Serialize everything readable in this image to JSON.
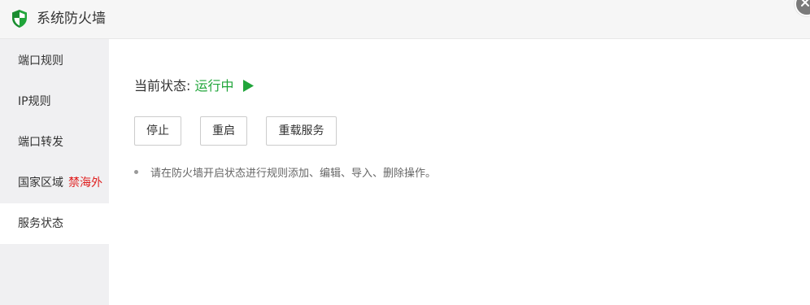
{
  "window": {
    "title": "系统防火墙"
  },
  "sidebar": {
    "items": [
      {
        "label": "端口规则"
      },
      {
        "label": "IP规则"
      },
      {
        "label": "端口转发"
      },
      {
        "label": "国家区域",
        "badge": "禁海外"
      },
      {
        "label": "服务状态",
        "active": true
      }
    ]
  },
  "main": {
    "status_label": "当前状态:",
    "status_value": "运行中",
    "buttons": {
      "stop": "停止",
      "restart": "重启",
      "reload": "重载服务"
    },
    "tip": "请在防火墙开启状态进行规则添加、编辑、导入、删除操作。"
  },
  "colors": {
    "accent_green": "#20a53a",
    "badge_red": "#e02020",
    "sidebar_bg": "#f0f0f2"
  },
  "icons": [
    "shield-icon",
    "close-icon",
    "play-icon"
  ]
}
